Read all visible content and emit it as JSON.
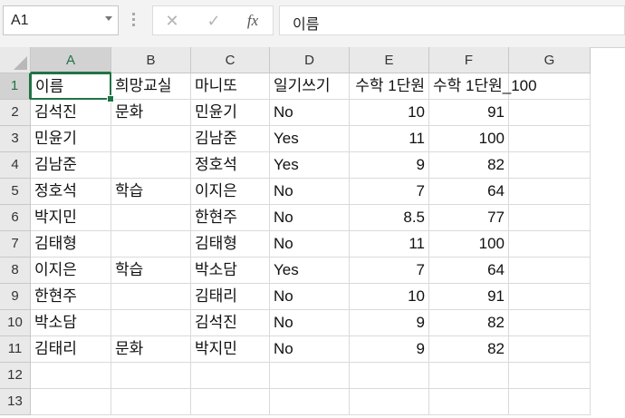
{
  "name_box": {
    "value": "A1"
  },
  "formula_bar": {
    "cancel_glyph": "✕",
    "enter_glyph": "✓",
    "fx_label": "fx",
    "content": "이름"
  },
  "columns": [
    "A",
    "B",
    "C",
    "D",
    "E",
    "F",
    "G"
  ],
  "rows": [
    "1",
    "2",
    "3",
    "4",
    "5",
    "6",
    "7",
    "8",
    "9",
    "10",
    "11",
    "12",
    "13"
  ],
  "selected_cell": "A1",
  "cells": [
    [
      "이름",
      "희망교실",
      "마니또",
      "일기쓰기",
      "수학 1단원",
      "수학 1단원_100",
      ""
    ],
    [
      "김석진",
      "문화",
      "민윤기",
      "No",
      "10",
      "91",
      ""
    ],
    [
      "민윤기",
      "",
      "김남준",
      "Yes",
      "11",
      "100",
      ""
    ],
    [
      "김남준",
      "",
      "정호석",
      "Yes",
      "9",
      "82",
      ""
    ],
    [
      "정호석",
      "학습",
      "이지은",
      "No",
      "7",
      "64",
      ""
    ],
    [
      "박지민",
      "",
      "한현주",
      "No",
      "8.5",
      "77",
      ""
    ],
    [
      "김태형",
      "",
      "김태형",
      "No",
      "11",
      "100",
      ""
    ],
    [
      "이지은",
      "학습",
      "박소담",
      "Yes",
      "7",
      "64",
      ""
    ],
    [
      "한현주",
      "",
      "김태리",
      "No",
      "10",
      "91",
      ""
    ],
    [
      "박소담",
      "",
      "김석진",
      "No",
      "9",
      "82",
      ""
    ],
    [
      "김태리",
      "문화",
      "박지민",
      "No",
      "9",
      "82",
      ""
    ],
    [
      "",
      "",
      "",
      "",
      "",
      "",
      ""
    ],
    [
      "",
      "",
      "",
      "",
      "",
      "",
      ""
    ]
  ],
  "colors": {
    "accent": "#217346",
    "header_bg": "#e9e9e9",
    "gridline": "#dadada"
  },
  "icons": [
    "dropdown-arrow-icon",
    "cancel-icon",
    "enter-icon",
    "function-icon",
    "select-all-icon"
  ]
}
